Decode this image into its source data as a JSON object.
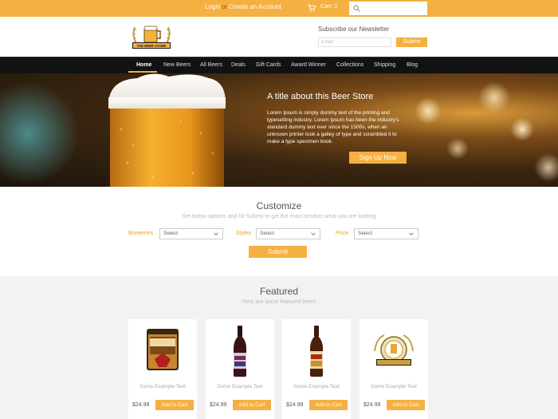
{
  "topbar": {
    "login": "Login",
    "separator": "or",
    "register": "Create an Account",
    "cart": "Cart: 0",
    "search_placeholder": ""
  },
  "header": {
    "logo_text": "THE BEER STORE",
    "newsletter_title": "Subscribe our Newsletter",
    "email_placeholder": "Email",
    "submit_label": "Submit"
  },
  "nav": {
    "items": [
      "Home",
      "New Beers",
      "All Beers",
      "Deals",
      "Gift Cards",
      "Award Winner",
      "Collections",
      "Shipping",
      "Blog"
    ],
    "active": "Home"
  },
  "hero": {
    "title": "A title about this Beer Store",
    "text": "Lorem Ipsum is simply dummy text of the printing and typesetting industry. Lorem Ipsum has been the industry's standard dummy text ever since the 1500s, when an unknown printer took a galley of type and scrambled it to make a type specimen book.",
    "button": "Sign Up Now"
  },
  "customize": {
    "title": "Customize",
    "subtitle": "Set below options and hit Submit to get the exact product what you are looking",
    "filters": [
      {
        "label": "Breweries",
        "value": "Select"
      },
      {
        "label": "Styles",
        "value": "Select"
      },
      {
        "label": "Price",
        "value": "Select"
      }
    ],
    "submit": "Submit"
  },
  "featured": {
    "title": "Featured",
    "subtitle": "Here are some featured beers",
    "products": [
      {
        "text": "Some Example Text",
        "price": "$24.99",
        "button": "Add to Cart"
      },
      {
        "text": "Some Example Text",
        "price": "$24.99",
        "button": "Add to Cart"
      },
      {
        "text": "Some Example Text",
        "price": "$24.99",
        "button": "Add to Cart"
      },
      {
        "text": "Some Example Text",
        "price": "$24.99",
        "button": "Add to Cart"
      }
    ]
  },
  "colors": {
    "accent": "#f5b042",
    "nav_bg": "#121212",
    "featured_bg": "#f2f2f2"
  }
}
